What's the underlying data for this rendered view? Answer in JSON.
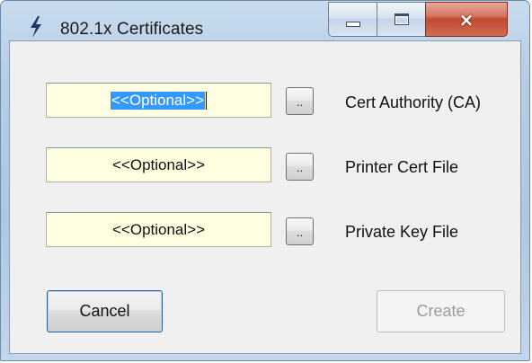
{
  "window": {
    "title": "802.1x Certificates",
    "icon": "lightning-bolt-icon",
    "controls": {
      "minimize": "minimize-icon",
      "maximize": "maximize-icon",
      "close": "×"
    }
  },
  "fields": [
    {
      "value": "<<Optional>>",
      "selected": true,
      "browse_label": "..",
      "label": "Cert Authority (CA)"
    },
    {
      "value": "<<Optional>>",
      "selected": false,
      "browse_label": "..",
      "label": "Printer Cert File"
    },
    {
      "value": "<<Optional>>",
      "selected": false,
      "browse_label": "..",
      "label": "Private Key File"
    }
  ],
  "buttons": {
    "cancel": "Cancel",
    "create": "Create"
  },
  "colors": {
    "field_background": "#ffffe1",
    "selection": "#3399ff",
    "close_button": "#c7432c"
  }
}
